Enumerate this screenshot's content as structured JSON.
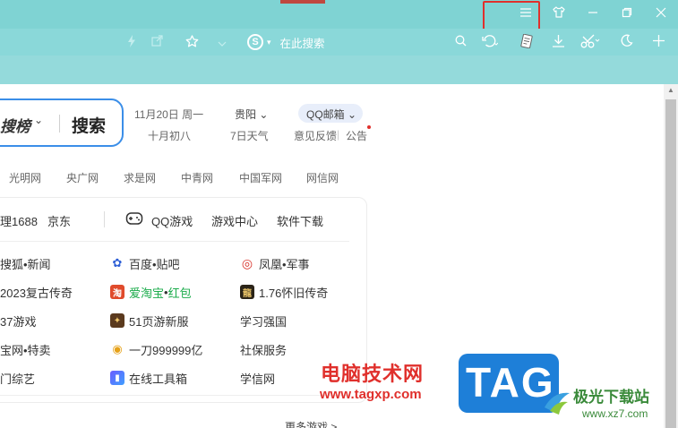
{
  "browser": {
    "toolbar": {
      "search_engine_icon": "S",
      "search_label": "在此搜索"
    }
  },
  "page": {
    "search_box": {
      "brand": "搜榜",
      "button_label": "搜索"
    },
    "info": {
      "date": "11月20日 周一",
      "lunar": "十月初八",
      "city": "贵阳",
      "weather": "7日天气",
      "mail": "QQ邮箱",
      "feedback": "意见反馈",
      "announce": "公告"
    },
    "nav_links": [
      "光明网",
      "央广网",
      "求是网",
      "中青网",
      "中国军网",
      "网信网"
    ],
    "quick_links": [
      "1688",
      "京东",
      "QQ游戏",
      "游戏中心",
      "软件下载"
    ],
    "sites": {
      "row1": [
        {
          "label": "搜狐•新闻",
          "icon": "sohu-icon"
        },
        {
          "label": "百度•贴吧",
          "icon": "baidu-icon"
        },
        {
          "label": "凤凰•军事",
          "icon": "ifeng-icon"
        }
      ],
      "row2": [
        {
          "label": "2023复古传奇",
          "icon": ""
        },
        {
          "label_a": "爱淘宝",
          "label_b": "•",
          "label_c": "红包",
          "icon": "taobao-icon"
        },
        {
          "label": "1.76怀旧传奇",
          "icon": "legend-icon"
        }
      ],
      "row3": [
        {
          "label": "37游戏",
          "icon": ""
        },
        {
          "label": "51页游新服",
          "icon": "51game-icon"
        },
        {
          "label": "学习强国",
          "icon": ""
        }
      ],
      "row4": [
        {
          "label": "宝网•特卖",
          "icon": ""
        },
        {
          "label": "一刀999999亿",
          "icon": "gold-icon"
        },
        {
          "label": "社保服务",
          "icon": ""
        }
      ],
      "row5": [
        {
          "label": "门综艺",
          "icon": ""
        },
        {
          "label": "在线工具箱",
          "icon": "toolbox-icon"
        },
        {
          "label": "学信网",
          "icon": ""
        }
      ]
    },
    "more_games": "更多游戏 >"
  },
  "watermark": {
    "text": "电脑技术网",
    "url": "www.tagxp.com",
    "badge": "TAG",
    "site_name": "极光下载站",
    "site_url": "www.xz7.com"
  },
  "colors": {
    "chrome": "#7fd3d3",
    "highlight": "#e0302c",
    "accent_blue": "#3b8ee8",
    "link_green": "#1aab4a"
  }
}
